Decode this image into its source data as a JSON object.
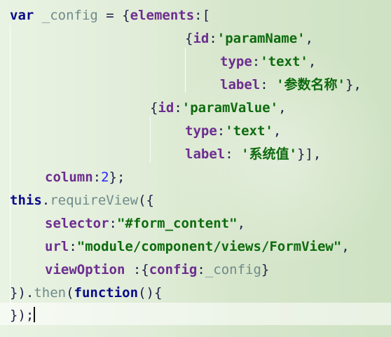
{
  "code": {
    "line1": {
      "kw_var": "var",
      "ident_config": "_config",
      "eq_open": " = {",
      "prop_elements": "elements",
      "colon_bracket": ":["
    },
    "line2": {
      "open": "{",
      "prop_id": "id",
      "colon": ":",
      "str_paramName": "'paramName'",
      "comma": ","
    },
    "line3": {
      "prop_type": "type",
      "colon": ":",
      "str_text": "'text'",
      "comma": ","
    },
    "line4": {
      "prop_label": "label",
      "colon": ": ",
      "str_label": "'参数名称'",
      "close": "},"
    },
    "line5": {
      "open": "{",
      "prop_id": "id",
      "colon": ":",
      "str_paramValue": "'paramValue'",
      "comma": ","
    },
    "line6": {
      "prop_type": "type",
      "colon": ":",
      "str_text": "'text'",
      "comma": ","
    },
    "line7": {
      "prop_label": "label",
      "colon": ": ",
      "str_label": "'系统值'",
      "close": "}],"
    },
    "line8": {
      "prop_column": "column",
      "colon": ":",
      "num_2": "2",
      "close": "};"
    },
    "line9": {
      "kw_this": "this",
      "dot": ".",
      "ident_requireView": "requireView",
      "open": "({"
    },
    "line10": {
      "prop_selector": "selector",
      "colon": ":",
      "str_selector": "\"#form_content\"",
      "comma": ","
    },
    "line11": {
      "prop_url": "url",
      "colon": ":",
      "str_url": "\"module/component/views/FormView\"",
      "comma": ","
    },
    "line12": {
      "prop_viewOption": "viewOption",
      "colon": " :{",
      "prop_config": "config",
      "colon2": ":",
      "ident_config": "_config",
      "close": "}"
    },
    "line13": {
      "close": "}).",
      "ident_then": "then",
      "open": "(",
      "kw_function": "function",
      "rest": "(){"
    },
    "line14": {
      "close": "});"
    }
  },
  "colors": {
    "keyword": "#0a0a8a",
    "property": "#6d2d8f",
    "string": "#0e6b0e",
    "number": "#2424ff",
    "identifier": "#6f8a8a",
    "current_line": "#ffffff"
  }
}
